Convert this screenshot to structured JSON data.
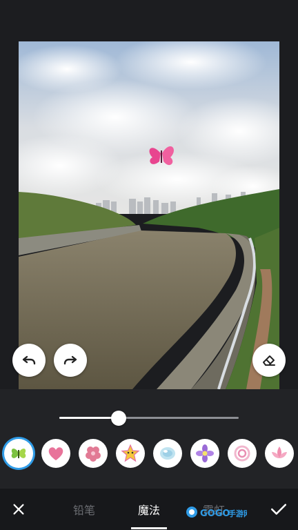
{
  "colors": {
    "background": "#1c1d20",
    "panel": "#222326",
    "tabbar": "#17181b",
    "accent_selected": "#2f9be6",
    "tab_inactive": "#6d6f74",
    "tab_active": "#ffffff"
  },
  "toolbar": {
    "undo_icon": "undo-icon",
    "redo_icon": "redo-icon",
    "eraser_icon": "eraser-icon"
  },
  "brush_size": {
    "value": 0.33
  },
  "stickers": [
    {
      "name": "butterfly",
      "selected": true
    },
    {
      "name": "heart",
      "selected": false
    },
    {
      "name": "blossom",
      "selected": false
    },
    {
      "name": "star",
      "selected": false
    },
    {
      "name": "bubble",
      "selected": false
    },
    {
      "name": "purple-flower",
      "selected": false
    },
    {
      "name": "swirl",
      "selected": false
    },
    {
      "name": "lotus",
      "selected": false
    }
  ],
  "tabs": [
    {
      "label": "铅笔",
      "active": false
    },
    {
      "label": "魔法",
      "active": true
    },
    {
      "label": "霓虹",
      "active": false
    }
  ],
  "actions": {
    "cancel_icon": "close-icon",
    "confirm_icon": "check-icon"
  },
  "watermark": {
    "text": "GOGO手游网"
  }
}
